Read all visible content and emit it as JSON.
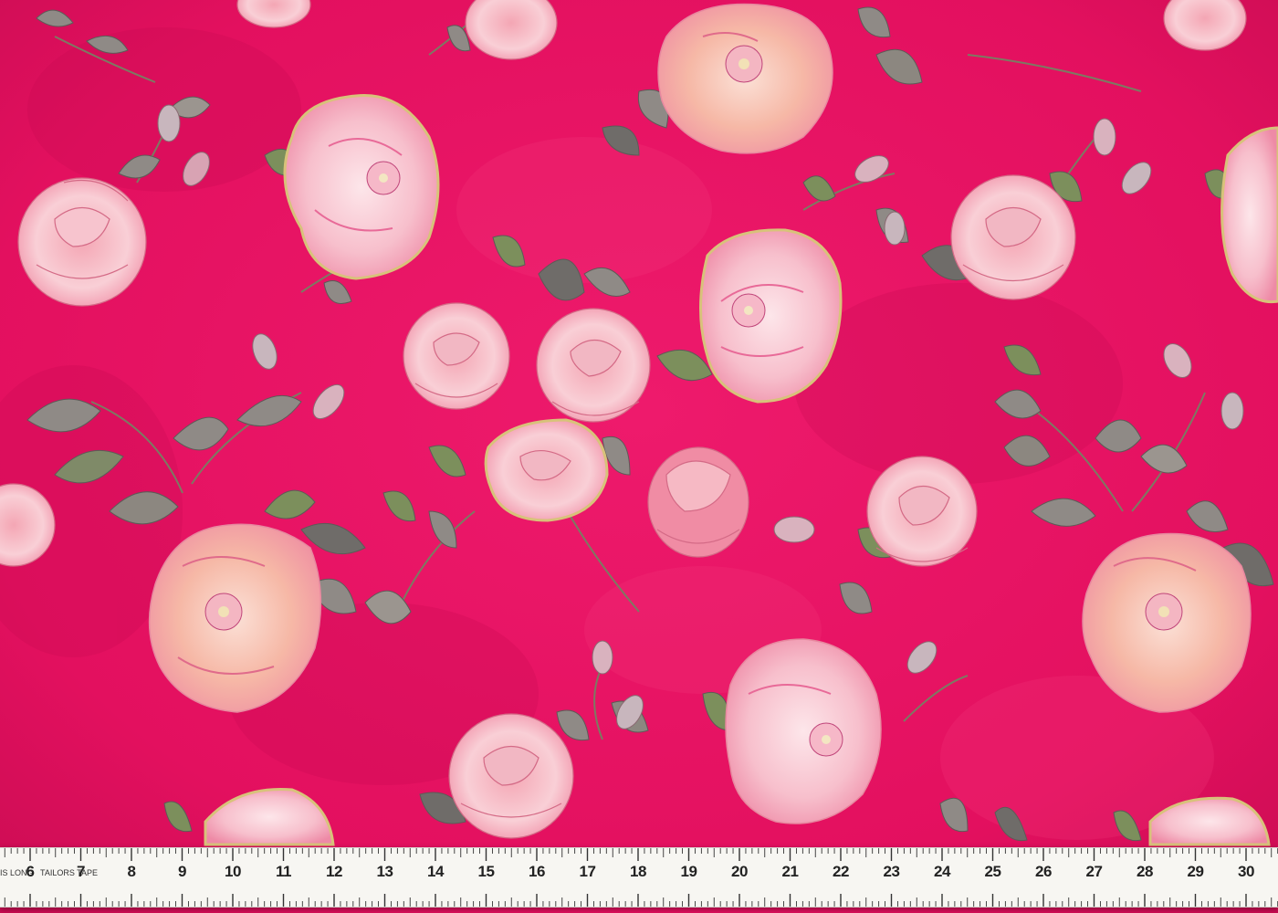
{
  "scene": {
    "colors": {
      "fabric": "#e3105f",
      "fabric_dark": "#b80a4c",
      "petal_light": "#fbd3dc",
      "petal_mid": "#f3a6b8",
      "petal_peach": "#f6b39a",
      "leaf": "#8f8a86",
      "leaf_green": "#7c8f5c",
      "gold_outline": "#d8c27a",
      "tape": "#f7f6f2"
    }
  },
  "tape": {
    "edge_text": "IS LONG",
    "brand_text": "TAILORS TAPE",
    "numbers": [
      "6",
      "7",
      "8",
      "9",
      "10",
      "11",
      "12",
      "13",
      "14",
      "15",
      "16",
      "17",
      "18",
      "19",
      "20",
      "21",
      "22",
      "23",
      "24",
      "25",
      "26",
      "27",
      "28",
      "29",
      "30"
    ]
  }
}
